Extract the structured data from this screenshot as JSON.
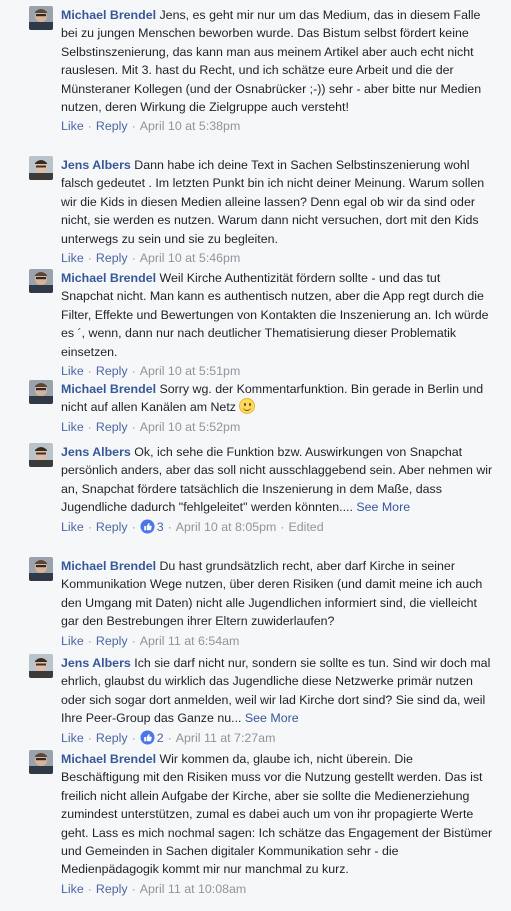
{
  "comments": [
    {
      "author": "Michael Brendel",
      "text": "Jens, es geht mir nur um das Medium, das in diesem Falle bei zu jungen Menschen beworben wurde. Das Bistum selbst fördert keine Selbstinszenierung, das kann man aus meinem Artikel aber auch echt nicht rauslesen. Mit 3. hast du Recht, und ich schätze eure Arbeit und die der Münsteraner Kollegen (und der Osnabrücker ;-)) sehr - aber bitte nur Medien nutzen, deren Wirkung die Zielgruppe auch versteht!",
      "like": "Like",
      "reply": "Reply",
      "time": "April 10 at 5:38pm"
    },
    {
      "author": "Jens Albers",
      "text": "Dann habe ich deine Text in Sachen Selbstinszenierung wohl falsch gedeutet . Im letzten Punkt bin ich nicht deiner Meinung. Warum sollen wir die Kids in diesen Medien alleine lassen? Denn egal ob wir da sind oder nicht, sie werden es nutzen. Warum dann nicht versuchen, dort mit den Kids unterwegs zu sein und sie zu begleiten.",
      "like": "Like",
      "reply": "Reply",
      "time": "April 10 at 5:46pm"
    },
    {
      "author": "Michael Brendel",
      "text": "Weil Kirche Authentizität fördern sollte - und das tut Snapchat nicht. Man kann es authentisch nutzen, aber die App regt durch die Filter, Effekte und Bewertungen von Kontakten die Inszenierung an. Ich würde es ´, wenn, dann nur nach deutlicher Thematisierung dieser Problematik einsetzen.",
      "like": "Like",
      "reply": "Reply",
      "time": "April 10 at 5:51pm"
    },
    {
      "author": "Michael Brendel",
      "text": "Sorry wg. der Kommentarfunktion. Bin gerade in Berlin und nicht auf allen Kanälen am Netz",
      "like": "Like",
      "reply": "Reply",
      "time": "April 10 at 5:52pm"
    },
    {
      "author": "Jens Albers",
      "text": "Ok, ich sehe die Funktion bzw. Auswirkungen von Snapchat persönlich anders, aber das soll nicht ausschlaggebend sein. Aber nehmen wir an, Snapchat fördere tatsächlich die Inszenierung in dem Maße, dass Jugendliche dadurch \"fehlgeleitet\" werden könnten....",
      "see_more": "See More",
      "like": "Like",
      "reply": "Reply",
      "reactions": "3",
      "time": "April 10 at 8:05pm",
      "edited": "Edited"
    },
    {
      "author": "Michael Brendel",
      "text": "Du hast grundsätzlich recht, aber darf Kirche in seiner Kommunikation Wege nutzen, über deren Risiken (und damit meine ich auch den Umgang mit Daten) nicht alle Jugendlichen informiert sind, die vielleicht gar den Bestrebungen ihrer Eltern zuwiderlaufen?",
      "like": "Like",
      "reply": "Reply",
      "time": "April 11 at 6:54am"
    },
    {
      "author": "Jens Albers",
      "text": "Ich sie darf nicht nur, sondern sie sollte es tun. Sind wir doch mal ehrlich, glaubst du wirklich das Jugendliche diese Netzwerke primär nutzen oder sich sogar dort anmelden, weil wir lad Kirche dort sind? Sie sind da, weil Ihre Peer-Group das Ganze nu...",
      "see_more": "See More",
      "like": "Like",
      "reply": "Reply",
      "reactions": "2",
      "time": "April 11 at 7:27am"
    },
    {
      "author": "Michael Brendel",
      "text": "Wir kommen da, glaube ich, nicht überein. Die Beschäftigung mit den Risiken muss vor die Nutzung gestellt werden. Das ist freilich nicht allein Aufgabe der Kirche, aber sie sollte die Medienerziehung zumindest unterstützen, zumal es dabei auch um von ihr propagierte Werte geht. Lass es mich nochmal sagen: Ich schätze das Engagement der Bistümer und Gemeinden in Sachen digitaler Kommunikation sehr - die Medienpädagogik kommt mir nur manchmal zu kurz.",
      "like": "Like",
      "reply": "Reply",
      "time": "April 11 at 10:08am"
    }
  ],
  "colors": {
    "link": "#365899",
    "meta": "#90949c",
    "background": "#f6f7f9"
  },
  "icons": {
    "avatar_michael": "avatar-michael-icon",
    "avatar_jens": "avatar-jens-icon",
    "smiley": "smiley-emoji-icon",
    "like_reaction": "like-reaction-icon"
  }
}
